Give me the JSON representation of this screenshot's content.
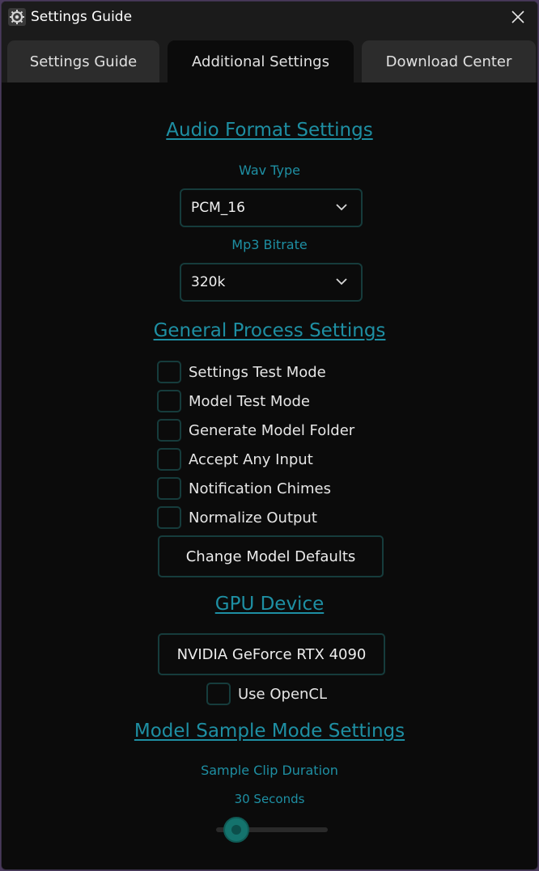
{
  "window": {
    "title": "Settings Guide",
    "icon": "gear-logo-icon",
    "close_icon": "close-icon"
  },
  "tabs": [
    {
      "label": "Settings Guide",
      "active": false
    },
    {
      "label": "Additional Settings",
      "active": true
    },
    {
      "label": "Download Center",
      "active": false
    }
  ],
  "audio_format": {
    "title": "Audio Format Settings",
    "wav_type_label": "Wav Type",
    "wav_type_value": "PCM_16",
    "mp3_bitrate_label": "Mp3 Bitrate",
    "mp3_bitrate_value": "320k"
  },
  "general_process": {
    "title": "General Process Settings",
    "options": [
      {
        "label": "Settings Test Mode",
        "checked": false
      },
      {
        "label": "Model Test Mode",
        "checked": false
      },
      {
        "label": "Generate Model Folder",
        "checked": false
      },
      {
        "label": "Accept Any Input",
        "checked": false
      },
      {
        "label": "Notification Chimes",
        "checked": false
      },
      {
        "label": "Normalize Output",
        "checked": false
      }
    ],
    "change_defaults_label": "Change Model Defaults"
  },
  "gpu": {
    "title": "GPU Device",
    "device_value": "NVIDIA GeForce RTX 4090",
    "opencl_label": "Use OpenCL",
    "opencl_checked": false
  },
  "sample_mode": {
    "title": "Model Sample Mode Settings",
    "clip_duration_label": "Sample Clip Duration",
    "clip_duration_value": "30 Seconds",
    "slider_fraction": 0.18
  },
  "colors": {
    "accent": "#1e8fa3",
    "border": "#163c3c",
    "background": "#0b0b0b",
    "thumb": "#14736d"
  }
}
